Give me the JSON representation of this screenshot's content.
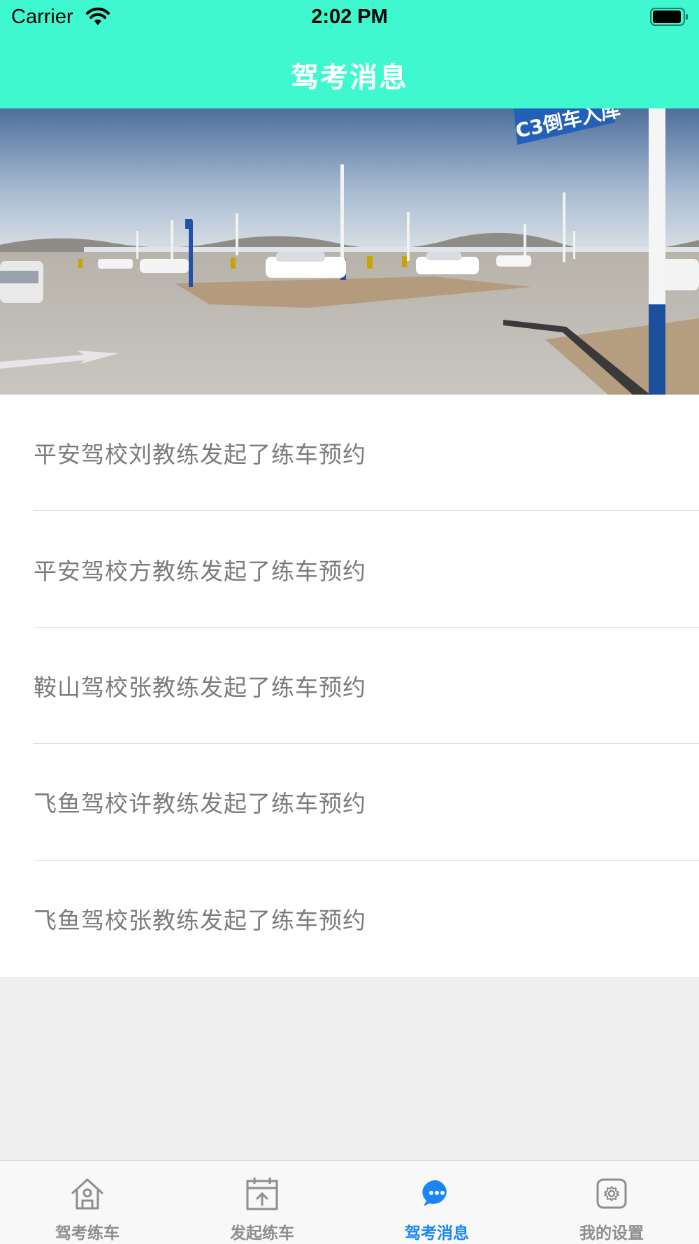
{
  "status_bar": {
    "carrier": "Carrier",
    "time": "2:02 PM"
  },
  "nav": {
    "title": "驾考消息",
    "background_color": "#3ff8d0"
  },
  "banner": {
    "sign_text": "C3倒车入库"
  },
  "messages": [
    {
      "text": "平安驾校刘教练发起了练车预约"
    },
    {
      "text": "平安驾校方教练发起了练车预约"
    },
    {
      "text": "鞍山驾校张教练发起了练车预约"
    },
    {
      "text": "飞鱼驾校许教练发起了练车预约"
    },
    {
      "text": "飞鱼驾校张教练发起了练车预约"
    }
  ],
  "tabbar": {
    "active_color": "#1a86f5",
    "inactive_color": "#8e8e8e",
    "tabs": [
      {
        "label": "驾考练车",
        "icon": "home-icon",
        "active": false
      },
      {
        "label": "发起练车",
        "icon": "calendar-upload-icon",
        "active": false
      },
      {
        "label": "驾考消息",
        "icon": "chat-bubble-icon",
        "active": true
      },
      {
        "label": "我的设置",
        "icon": "settings-gear-icon",
        "active": false
      }
    ]
  }
}
